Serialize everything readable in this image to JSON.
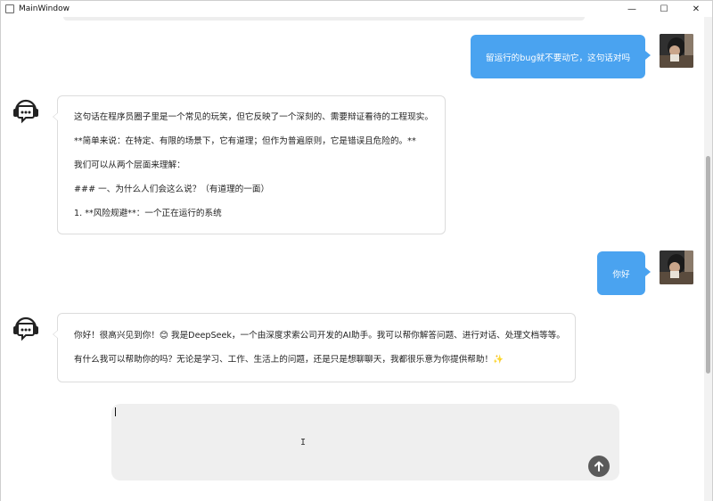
{
  "window": {
    "title": "MainWindow",
    "controls": {
      "minimize": "—",
      "maximize": "☐",
      "close": "✕"
    }
  },
  "messages": [
    {
      "role": "user",
      "text": "留运行的bug就不要动它，这句话对吗"
    },
    {
      "role": "assistant",
      "lines": [
        "这句话在程序员圈子里是一个常见的玩笑，但它反映了一个深刻的、需要辩证看待的工程现实。",
        "**简单来说：在特定、有限的场景下，它有道理；但作为普遍原则，它是错误且危险的。**",
        "我们可以从两个层面来理解：",
        "### 一、为什么人们会这么说？（有道理的一面）",
        "1. **风险规避**：一个正在运行的系统"
      ]
    },
    {
      "role": "user",
      "text": "你好"
    },
    {
      "role": "assistant",
      "lines": [
        "你好！很高兴见到你！😊 我是DeepSeek，一个由深度求索公司开发的AI助手。我可以帮你解答问题、进行对话、处理文档等等。",
        "有什么我可以帮助你的吗？无论是学习、工作、生活上的问题，还是只是想聊聊天，我都很乐意为你提供帮助！✨"
      ]
    }
  ],
  "input": {
    "value": "",
    "send_icon": "arrow-up-icon"
  },
  "colors": {
    "user_bubble": "#4aa3f0",
    "input_bg": "#efefef",
    "send_button": "#5a5a5a"
  }
}
